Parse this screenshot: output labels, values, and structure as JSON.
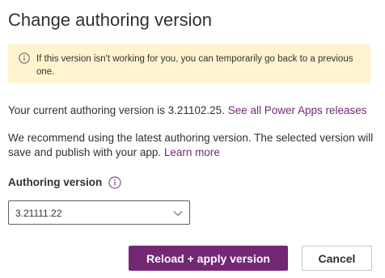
{
  "dialog": {
    "title": "Change authoring version"
  },
  "banner": {
    "icon": "info-icon",
    "text": "If this version isn't working for you, you can temporarily go back to a previous one."
  },
  "current": {
    "text": "Your current authoring version is 3.21102.25. ",
    "link": "See all Power Apps releases"
  },
  "recommend": {
    "text": "We recommend using the latest authoring version. The selected version will save and publish with your app. ",
    "link": "Learn more"
  },
  "field": {
    "label": "Authoring version",
    "info_icon": "info-icon",
    "selected": "3.21111.22",
    "chevron_icon": "chevron-down-icon"
  },
  "buttons": {
    "primary": "Reload + apply version",
    "secondary": "Cancel"
  },
  "colors": {
    "accent": "#742774",
    "banner_bg": "#fff4ce",
    "text": "#323130"
  }
}
